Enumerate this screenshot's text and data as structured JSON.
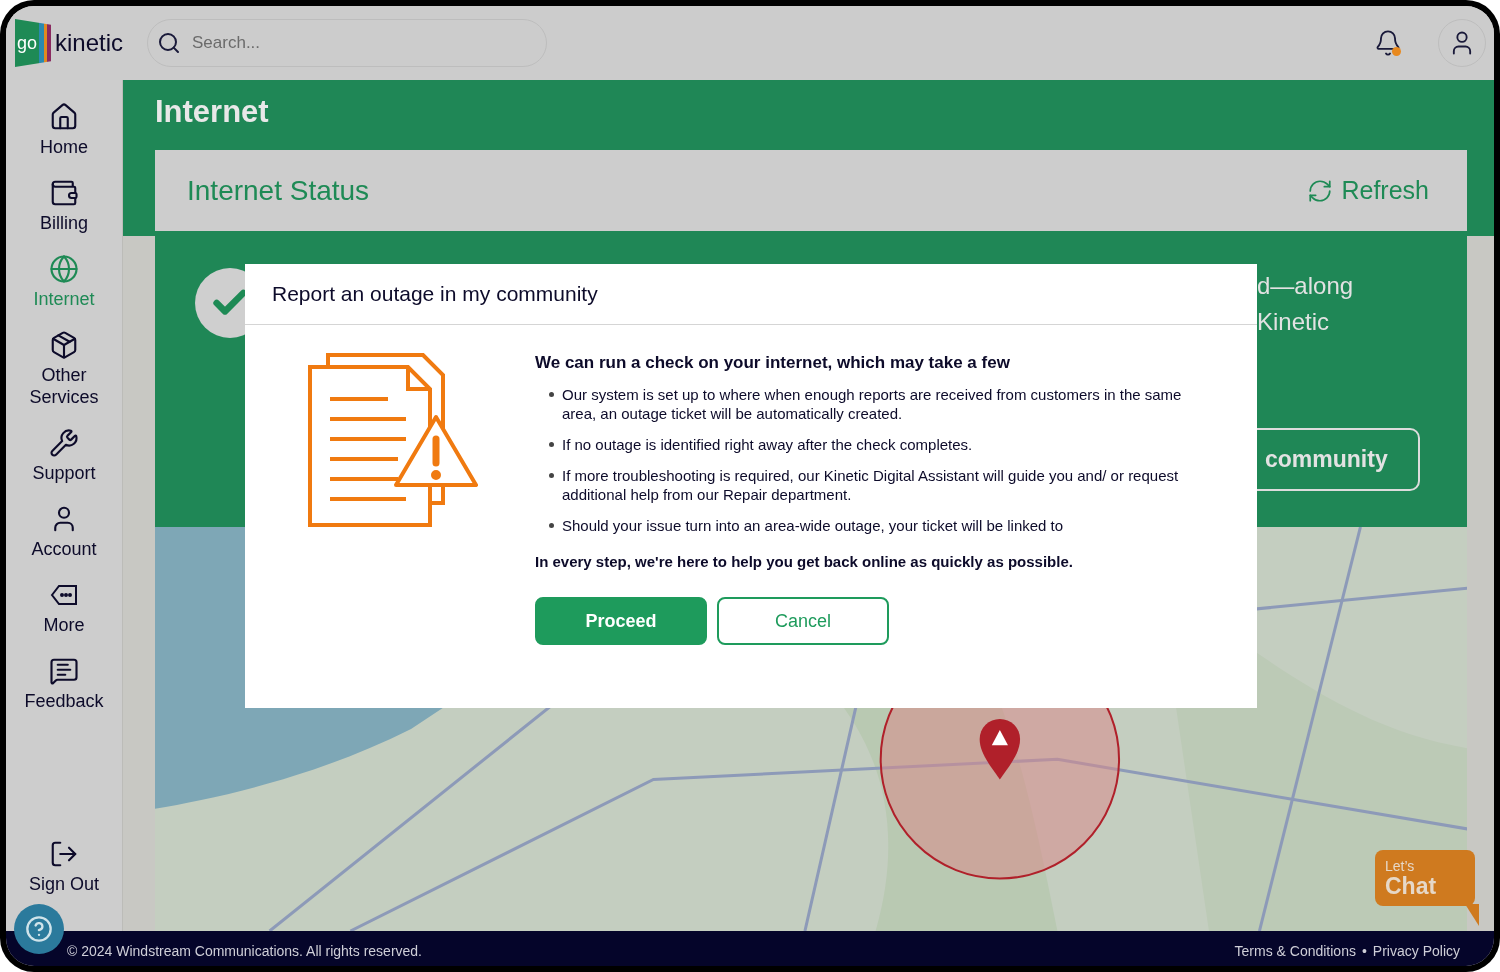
{
  "header": {
    "logo": {
      "prefix": "go",
      "name": "kinetic"
    },
    "search": {
      "placeholder": "Search..."
    },
    "notifications": {
      "unread": true
    }
  },
  "sidebar": {
    "items": [
      {
        "label": "Home",
        "kind": "home",
        "selected": false
      },
      {
        "label": "Billing",
        "kind": "billing",
        "selected": false
      },
      {
        "label": "Internet",
        "kind": "internet",
        "selected": true
      },
      {
        "label": "Other Services",
        "kind": "services",
        "selected": false
      },
      {
        "label": "Support",
        "kind": "support",
        "selected": false
      },
      {
        "label": "Account",
        "kind": "account",
        "selected": false
      },
      {
        "label": "More",
        "kind": "more",
        "selected": false
      },
      {
        "label": "Feedback",
        "kind": "feedback",
        "selected": false
      }
    ],
    "sign_out": "Sign Out"
  },
  "page": {
    "title": "Internet",
    "card": {
      "title": "Internet Status",
      "refresh": "Refresh",
      "status_lines": [
        "d—along",
        "Kinetic"
      ],
      "report_button": "community"
    }
  },
  "chat": {
    "line1": "Let’s",
    "line2": "Chat"
  },
  "footer": {
    "copyright": "© 2024 Windstream Communications. All rights reserved.",
    "links": [
      "Terms & Conditions",
      "Privacy Policy"
    ],
    "separator": "•"
  },
  "dialog": {
    "title": "Report an outage in my community",
    "heading": "We can run a check on your internet, which may take a few",
    "bullets": [
      "Our system is set up to where when enough reports are received from customers in the same area, an outage ticket will be automatically created.",
      "If no outage is identified right away after the check completes.",
      "If more troubleshooting is required, our Kinetic Digital Assistant will guide you and/ or request additional help from our Repair department.",
      "Should your issue turn into an area-wide outage, your ticket will be linked to"
    ],
    "closing": "In every step, we're here to help you get back online as quickly as possible.",
    "buttons": [
      {
        "label": "Proceed",
        "kind": "primary"
      },
      {
        "label": "Cancel",
        "kind": "secondary"
      }
    ]
  }
}
